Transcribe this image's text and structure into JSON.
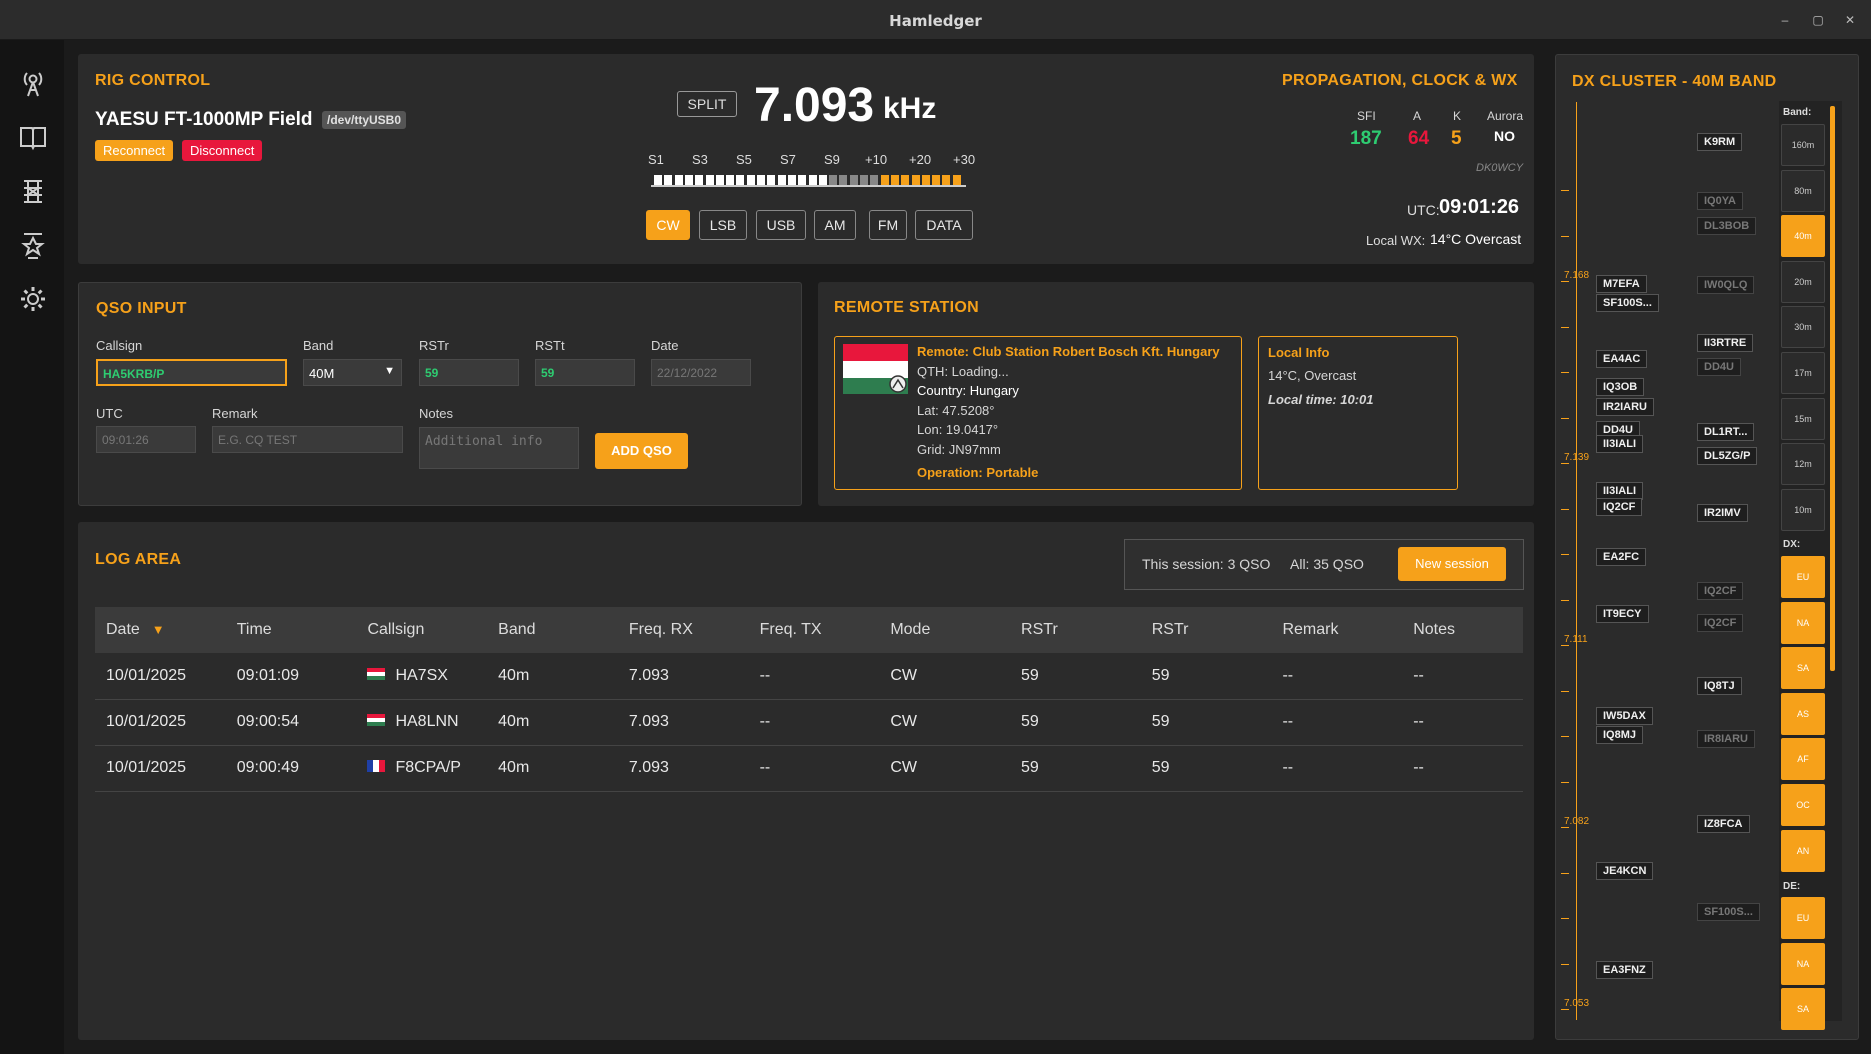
{
  "window": {
    "title": "Hamledger"
  },
  "rig": {
    "section_title": "RIG CONTROL",
    "model": "YAESU FT-1000MP Field",
    "port": "/dev/ttyUSB0",
    "reconnect_label": "Reconnect",
    "disconnect_label": "Disconnect",
    "split_label": "SPLIT",
    "frequency": "7.093",
    "frequency_unit": "kHz",
    "meter_labels": [
      "S1",
      "S3",
      "S5",
      "S7",
      "S9",
      "+10",
      "+20",
      "+30"
    ],
    "modes": [
      "CW",
      "LSB",
      "USB",
      "AM",
      "FM",
      "DATA"
    ],
    "active_mode": "CW"
  },
  "propagation": {
    "section_title": "PROPAGATION, CLOCK & WX",
    "sfi_label": "SFI",
    "sfi": "187",
    "a_label": "A",
    "a": "64",
    "k_label": "K",
    "k": "5",
    "aurora_label": "Aurora",
    "aurora": "NO",
    "source": "DK0WCY",
    "utc_label": "UTC:",
    "utc_time": "09:01:26",
    "wx_label": "Local WX:",
    "wx_value": "14°C Overcast"
  },
  "qso_input": {
    "section_title": "QSO INPUT",
    "callsign_label": "Callsign",
    "callsign_value": "HA5KRB/P",
    "band_label": "Band",
    "band_value": "40M",
    "rstr_label": "RSTr",
    "rstr_value": "59",
    "rstt_label": "RSTt",
    "rstt_value": "59",
    "date_label": "Date",
    "date_placeholder": "22/12/2022",
    "utc_label": "UTC",
    "utc_placeholder": "09:01:26",
    "remark_label": "Remark",
    "remark_placeholder": "E.G. CQ TEST",
    "notes_label": "Notes",
    "notes_placeholder": "Additional info",
    "add_label": "ADD QSO"
  },
  "remote_station": {
    "section_title": "REMOTE STATION",
    "remote_name": "Remote: Club Station Robert Bosch Kft. Hungary",
    "qth": "QTH: Loading...",
    "country": "Country: Hungary",
    "lat": "Lat: 47.5208°",
    "lon": "Lon: 19.0417°",
    "grid": "Grid: JN97mm",
    "operation": "Operation: Portable",
    "local_info_title": "Local Info",
    "local_weather": "14°C, Overcast",
    "local_time": "Local time: 10:01"
  },
  "log": {
    "section_title": "LOG AREA",
    "session_text": "This session: 3 QSO",
    "all_text": "All: 35 QSO",
    "new_session_label": "New session",
    "columns": [
      "Date",
      "Time",
      "Callsign",
      "Band",
      "Freq. RX",
      "Freq. TX",
      "Mode",
      "RSTr",
      "RSTr",
      "Remark",
      "Notes"
    ],
    "rows": [
      {
        "date": "10/01/2025",
        "time": "09:01:09",
        "flag": "hu",
        "callsign": "HA7SX",
        "band": "40m",
        "freq_rx": "7.093",
        "freq_tx": "--",
        "mode": "CW",
        "rstr": "59",
        "rstt": "59",
        "remark": "--",
        "notes": "--"
      },
      {
        "date": "10/01/2025",
        "time": "09:00:54",
        "flag": "hu",
        "callsign": "HA8LNN",
        "band": "40m",
        "freq_rx": "7.093",
        "freq_tx": "--",
        "mode": "CW",
        "rstr": "59",
        "rstt": "59",
        "remark": "--",
        "notes": "--"
      },
      {
        "date": "10/01/2025",
        "time": "09:00:49",
        "flag": "fr",
        "callsign": "F8CPA/P",
        "band": "40m",
        "freq_rx": "7.093",
        "freq_tx": "--",
        "mode": "CW",
        "rstr": "59",
        "rstt": "59",
        "remark": "--",
        "notes": "--"
      }
    ]
  },
  "dx_cluster": {
    "section_title": "DX CLUSTER - 40M BAND",
    "freq_ticks": [
      "7.168",
      "7.139",
      "7.111",
      "7.082",
      "7.053"
    ],
    "left_spots": [
      "M7EFA",
      "SF100S...",
      "EA4AC",
      "IQ3OB",
      "IR2IARU",
      "DD4U",
      "II3IALI",
      "II3IALI",
      "IQ2CF",
      "EA2FC",
      "IT9ECY",
      "IW5DAX",
      "IQ8MJ",
      "JE4KCN",
      "EA3FNZ"
    ],
    "right_spots": [
      "K9RM",
      "IQ0YA",
      "DL3BOB",
      "IW0QLQ",
      "II3RTRE",
      "DD4U",
      "DL1RT...",
      "DL5ZG/P",
      "IR2IMV",
      "IQ2CF",
      "IQ2CF",
      "IQ8TJ",
      "IR8IARU",
      "IZ8FCA",
      "SF100S..."
    ],
    "band_label": "Band:",
    "bands": [
      "160m",
      "80m",
      "40m",
      "20m",
      "30m",
      "17m",
      "15m",
      "12m",
      "10m"
    ],
    "active_band": "40m",
    "dx_label": "DX:",
    "dx_continents": [
      "EU",
      "NA",
      "SA",
      "AS",
      "AF",
      "OC",
      "AN"
    ],
    "de_label": "DE:",
    "de_continents": [
      "EU",
      "NA",
      "SA"
    ]
  },
  "colors": {
    "accent": "#f6a11a",
    "green": "#2ecc71",
    "red": "#e8173c",
    "panel": "#2b2b2b"
  }
}
